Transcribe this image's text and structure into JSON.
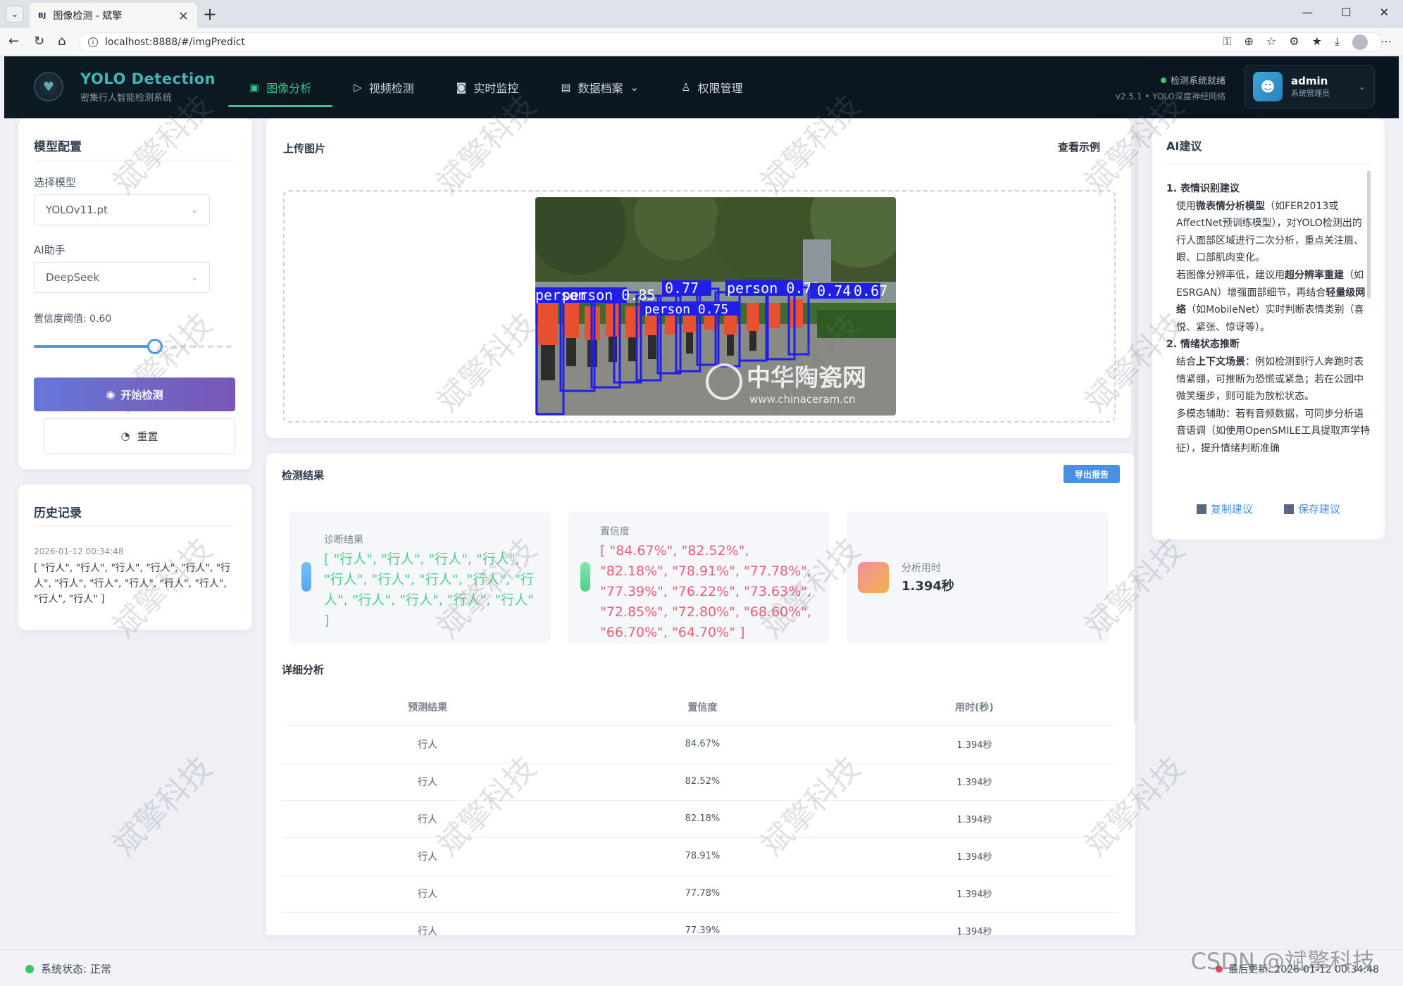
{
  "browser": {
    "tab_favicon": "BJ",
    "tab_title": "图像检测 - 斌擎",
    "url": "localhost:8888/#/imgPredict"
  },
  "header": {
    "brand_title": "YOLO Detection",
    "brand_subtitle": "密集行人智能检测系统",
    "nav": [
      {
        "label": "图像分析",
        "icon": "image-icon"
      },
      {
        "label": "视频检测",
        "icon": "play-circle-icon"
      },
      {
        "label": "实时监控",
        "icon": "camera-icon"
      },
      {
        "label": "数据档案",
        "icon": "document-icon"
      },
      {
        "label": "权限管理",
        "icon": "user-icon"
      }
    ],
    "system_status": "检测系统就绪",
    "version": "v2.5.1 • YOLO深度神经网络",
    "user_name": "admin",
    "user_role": "系统管理员"
  },
  "model_config": {
    "title": "模型配置",
    "model_label": "选择模型",
    "model_value": "YOLOv11.pt",
    "assistant_label": "AI助手",
    "assistant_value": "DeepSeek",
    "confidence_label": "置信度阈值: 0.60",
    "confidence_value": 0.6,
    "start_button": "开始检测",
    "reset_button": "重置"
  },
  "history": {
    "title": "历史记录",
    "time": "2026-01-12 00:34:48",
    "text": "[ \"行人\", \"行人\", \"行人\", \"行人\", \"行人\", \"行人\", \"行人\", \"行人\", \"行人\", \"行人\", \"行人\", \"行人\", \"行人\" ]"
  },
  "upload": {
    "title": "上传图片",
    "example_link": "查看示例",
    "image_labels": [
      "person",
      "person 0.85",
      "0.77",
      "person 0.79",
      "0.74",
      "0.67",
      "person 0.75"
    ],
    "image_watermark": "中华陶瓷网",
    "image_watermark_url": "www.chinaceram.cn"
  },
  "results": {
    "title": "检测结果",
    "export_button": "导出报告",
    "diagnosis_label": "诊断结果",
    "diagnosis_value": "[ \"行人\", \"行人\", \"行人\", \"行人\", \"行人\", \"行人\", \"行人\", \"行人\", \"行人\", \"行人\", \"行人\", \"行人\", \"行人\" ]",
    "confidence_label": "置信度",
    "confidence_value": "[ \"84.67%\", \"82.52%\", \"82.18%\", \"78.91%\", \"77.78%\", \"77.39%\", \"76.22%\", \"73.63%\", \"72.85%\", \"72.80%\", \"68.60%\", \"66.70%\", \"64.70%\" ]",
    "time_label": "分析用时",
    "time_value": "1.394秒",
    "detail_title": "详细分析",
    "columns": [
      "预测结果",
      "置信度",
      "用时(秒)"
    ],
    "rows": [
      {
        "label": "行人",
        "conf": "84.67%",
        "time": "1.394秒"
      },
      {
        "label": "行人",
        "conf": "82.52%",
        "time": "1.394秒"
      },
      {
        "label": "行人",
        "conf": "82.18%",
        "time": "1.394秒"
      },
      {
        "label": "行人",
        "conf": "78.91%",
        "time": "1.394秒"
      },
      {
        "label": "行人",
        "conf": "77.78%",
        "time": "1.394秒"
      },
      {
        "label": "行人",
        "conf": "77.39%",
        "time": "1.394秒"
      }
    ]
  },
  "ai": {
    "title": "AI建议",
    "h1": "1. 表情识别建议",
    "p1a_pre": "使用",
    "p1a_bold": "微表情分析模型",
    "p1a_post": "（如FER2013或AffectNet预训练模型），对YOLO检测出的行人面部区域进行二次分析，重点关注眉、眼、口部肌肉变化。",
    "p1b_pre": "若图像分辨率低，建议用",
    "p1b_bold1": "超分辨率重建",
    "p1b_mid": "（如ESRGAN）增强面部细节，再结合",
    "p1b_bold2": "轻量级网络",
    "p1b_post": "（如MobileNet）实时判断表情类别（喜悦、紧张、惊讶等）。",
    "h2": "2. 情绪状态推断",
    "p2a_pre": "结合",
    "p2a_bold": "上下文场景",
    "p2a_post": "：例如检测到行人奔跑时表情紧绷，可推断为恐慌或紧急；若在公园中微笑缓步，则可能为放松状态。",
    "p2b": "多模态辅助：若有音频数据，可同步分析语音语调（如使用OpenSMILE工具提取声学特征），提升情绪判断准确",
    "copy_button": "复制建议",
    "save_button": "保存建议"
  },
  "footer": {
    "status": "系统状态: 正常",
    "last_update": "最后更新: 2026-01-12 00:34:48",
    "csdn": "CSDN @斌擎科技"
  },
  "watermark_text": "斌擎科技",
  "colors": {
    "accent_green": "#3fc28c",
    "brand_teal": "#3fb6b9",
    "diagnosis_green": "#4cd08a",
    "confidence_red": "#e8607a",
    "primary_gradient_start": "#6677d8",
    "primary_gradient_end": "#7a56b5",
    "export_blue": "#4a90e2"
  }
}
